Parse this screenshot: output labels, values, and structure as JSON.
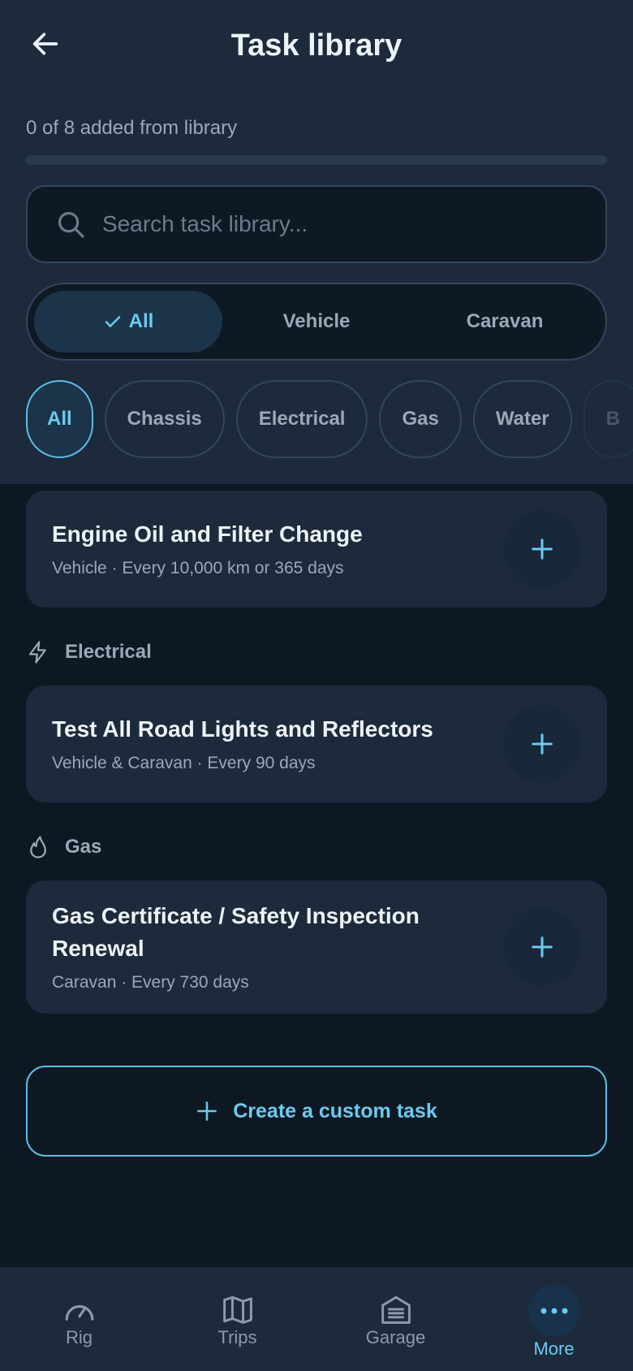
{
  "header": {
    "title": "Task library",
    "progress_text": "0 of 8 added from library",
    "progress_fraction": 0
  },
  "search": {
    "placeholder": "Search task library...",
    "value": ""
  },
  "scope_tabs": [
    {
      "label": "All",
      "active": true
    },
    {
      "label": "Vehicle",
      "active": false
    },
    {
      "label": "Caravan",
      "active": false
    }
  ],
  "category_chips": [
    {
      "label": "All",
      "active": true
    },
    {
      "label": "Chassis",
      "active": false
    },
    {
      "label": "Electrical",
      "active": false
    },
    {
      "label": "Gas",
      "active": false
    },
    {
      "label": "Water",
      "active": false
    },
    {
      "label": "B",
      "active": false
    }
  ],
  "tasks": {
    "engine_oil": {
      "title": "Engine Oil and Filter Change",
      "subtitle": "Vehicle · Every 10,000 km or 365 days"
    },
    "electrical_header": "Electrical",
    "road_lights": {
      "title": "Test All Road Lights and Reflectors",
      "subtitle": "Vehicle & Caravan · Every 90 days"
    },
    "gas_header": "Gas",
    "gas_cert": {
      "title_line1": "Gas Certificate / Safety Inspection",
      "title_line2": "Renewal",
      "subtitle": "Caravan · Every 730 days"
    }
  },
  "create_button": {
    "label": "Create a custom task"
  },
  "bottom_nav": [
    {
      "label": "Rig",
      "icon": "gauge-icon",
      "active": false
    },
    {
      "label": "Trips",
      "icon": "map-icon",
      "active": false
    },
    {
      "label": "Garage",
      "icon": "garage-icon",
      "active": false
    },
    {
      "label": "More",
      "icon": "more-dots-icon",
      "active": true
    }
  ],
  "colors": {
    "accent": "#5bbde6",
    "background": "#0e1822",
    "surface": "#1c2a3c"
  }
}
